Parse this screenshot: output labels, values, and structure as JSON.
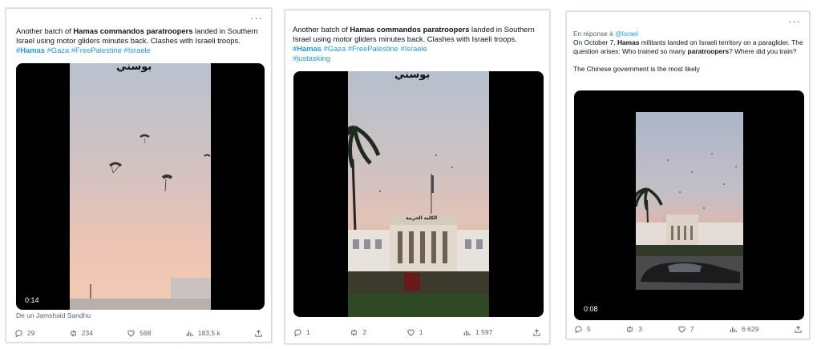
{
  "tweets": [
    {
      "more": "···",
      "text_parts": {
        "p1": "Another batch of ",
        "bold": "Hamas commandos paratroopers",
        "p2": " landed in Southern Israel using motor gliders minutes back. Clashes with Israeli troops."
      },
      "hashtags": [
        "#Hamas",
        "#Gaza",
        "#FreePalestine",
        "#Israele"
      ],
      "video": {
        "overlay": "بوسني",
        "duration": "0:14"
      },
      "overlap_text": "De  un Jamshaid Sandhu",
      "actions": {
        "replies": "29",
        "retweets": "234",
        "likes": "568",
        "views": "183,5 k"
      }
    },
    {
      "more": "···",
      "text_parts": {
        "p1": "Another batch of ",
        "bold": "Hamas commandos paratroopers",
        "p2": " landed in Southern Israel using motor gliders minutes back. Clashes with Israeli troops."
      },
      "hashtags": [
        "#Hamas",
        "#Gaza",
        "#FreePalestine",
        "#Israele",
        "#justasking"
      ],
      "video": {
        "overlay": "بوسني",
        "building_sign": "الكلية الحربية"
      },
      "actions": {
        "replies": "1",
        "retweets": "2",
        "likes": "1",
        "views": "1 597"
      }
    },
    {
      "more": "···",
      "reply_prefix": "En réponse à ",
      "reply_mention": "@Israel",
      "text_parts": {
        "p1": "On October 7, ",
        "bold": "Hamas",
        "p2": " militants landed on Israeli territory on a paraglider. The question arises: Who trained so many ",
        "bold2": "paratroopers",
        "p3": "? Where did you train?"
      },
      "second_paragraph": "The Chinese government is the most likely",
      "video": {
        "duration": "0:08"
      },
      "actions": {
        "replies": "5",
        "retweets": "3",
        "likes": "7",
        "views": "6 629"
      }
    }
  ],
  "colors": {
    "link": "#1d9bf0",
    "muted": "#536471",
    "border": "#cfd9de"
  },
  "icons": [
    "reply-icon",
    "retweet-icon",
    "like-icon",
    "views-icon",
    "share-icon"
  ]
}
